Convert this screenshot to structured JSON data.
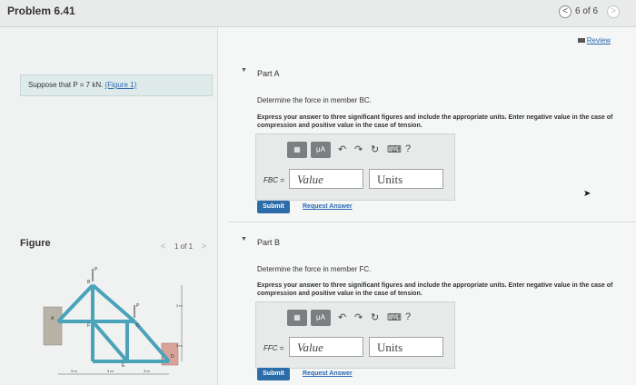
{
  "header": {
    "title": "Problem 6.41",
    "nav_prev": "<",
    "nav_count": "6 of 6",
    "nav_next": ">"
  },
  "left": {
    "prompt_prefix": "Suppose that P = 7 kN. ",
    "prompt_link": "(Figure 1)",
    "figure_label": "Figure",
    "fig_prev": "<",
    "fig_count": "1 of 1",
    "fig_next": ">",
    "truss_labels": {
      "P1": "P",
      "P2": "P",
      "A": "A",
      "B": "B",
      "C": "C",
      "D": "D",
      "E": "E",
      "F": "F",
      "dim1": "3 m",
      "dim2": "3 m",
      "dim3": "3 m",
      "dim4": "3 m",
      "dim5": "3 m"
    }
  },
  "review": "Review",
  "partA": {
    "label": "Part A",
    "question": "Determine the force in member BC.",
    "instructions": "Express your answer to three significant figures and include the appropriate units. Enter negative value in the case of compression and positive value in the case of tension.",
    "var_label": "FBC =",
    "value_placeholder": "Value",
    "units_placeholder": "Units",
    "submit": "Submit",
    "request": "Request Answer"
  },
  "partB": {
    "label": "Part B",
    "question": "Determine the force in member FC.",
    "instructions": "Express your answer to three significant figures and include the appropriate units. Enter negative value in the case of compression and positive value in the case of tension.",
    "var_label": "FFC =",
    "value_placeholder": "Value",
    "units_placeholder": "Units",
    "submit": "Submit",
    "request": "Request Answer"
  },
  "toolbar": {
    "template_icon": "template-icon",
    "mu_label": "μA",
    "undo_icon": "undo-icon",
    "redo_icon": "redo-icon",
    "reset_icon": "reset-icon",
    "keyboard_icon": "keyboard-icon",
    "help": "?"
  },
  "colors": {
    "accent": "#2b6ca9",
    "prompt_bg": "#dfeaea",
    "toolbar_btn": "#7b7f82"
  }
}
